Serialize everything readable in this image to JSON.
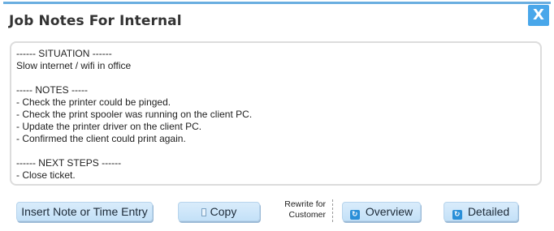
{
  "dialog": {
    "title": "Job Notes For Internal",
    "close_label": "X"
  },
  "notes": {
    "text": "------ SITUATION ------\nSlow internet / wifi in office\n\n----- NOTES -----\n- Check the printer could be pinged.\n- Check the print spooler was running on the client PC.\n- Update the printer driver on the client PC.\n- Confirmed the client could print again.\n\n------ NEXT STEPS ------\n- Close ticket."
  },
  "toolbar": {
    "insert_label": "Insert Note or Time Entry",
    "copy_label": "Copy",
    "rewrite_line1": "Rewrite for",
    "rewrite_line2": "Customer",
    "overview_label": "Overview",
    "detailed_label": "Detailed"
  },
  "icons": {
    "close": "close-icon",
    "copy": "copy-icon",
    "overview": "refresh-icon",
    "detailed": "refresh-icon"
  },
  "colors": {
    "accent": "#49a7ea",
    "button_bg": "#c4e1f8",
    "top_bar": "#6aaee0"
  }
}
